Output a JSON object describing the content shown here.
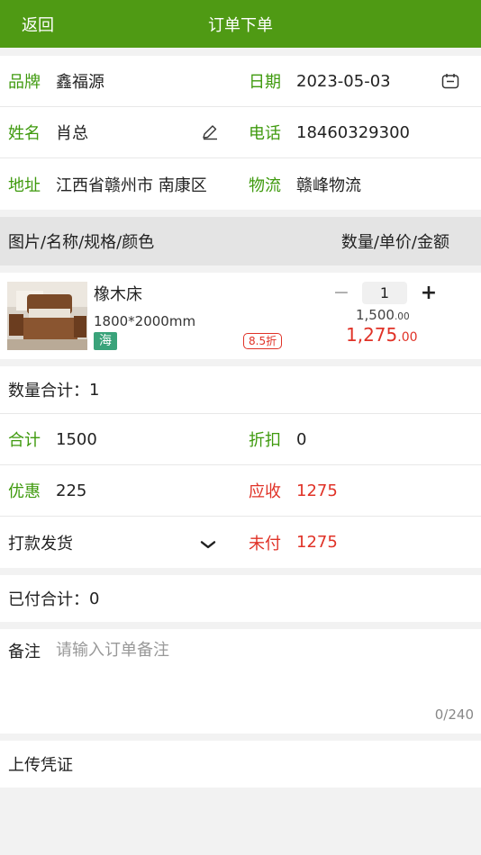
{
  "header": {
    "back_label": "返回",
    "title": "订单下单"
  },
  "info": {
    "brand_label": "品牌",
    "brand_value": "鑫福源",
    "date_label": "日期",
    "date_value": "2023-05-03",
    "name_label": "姓名",
    "name_value": "肖总",
    "phone_label": "电话",
    "phone_value": "18460329300",
    "address_label": "地址",
    "address_value": "江西省赣州市 南康区",
    "logistics_label": "物流",
    "logistics_value": "赣峰物流"
  },
  "table_head": {
    "left": "图片/名称/规格/颜色",
    "right": "数量/单价/金额"
  },
  "product": {
    "name": "橡木床",
    "spec": "1800*2000mm",
    "tag": "海",
    "discount_badge": "8.5折",
    "quantity": "1",
    "unit_price_main": "1,500",
    "unit_price_dec": ".00",
    "amount_main": "1,275",
    "amount_dec": ".00"
  },
  "summary": {
    "qty_total_label": "数量合计：",
    "qty_total_value": "1",
    "total_label": "合计",
    "total_value": "1500",
    "discount_label": "折扣",
    "discount_value": "0",
    "promo_label": "优惠",
    "promo_value": "225",
    "receivable_label": "应收",
    "receivable_value": "1275",
    "payment_mode": "打款发货",
    "unpaid_label": "未付",
    "unpaid_value": "1275"
  },
  "paid": {
    "label": "已付合计：",
    "value": "0"
  },
  "remark": {
    "label": "备注",
    "placeholder": "请输入订单备注",
    "counter": "0/240"
  },
  "upload": {
    "label": "上传凭证"
  },
  "colors": {
    "header_green": "#4f9a14",
    "label_green": "#3f9a0e",
    "accent_red": "#e03227"
  },
  "icons": [
    "calendar-icon",
    "edit-pen-icon",
    "chevron-down-icon",
    "minus-icon",
    "plus-icon"
  ]
}
